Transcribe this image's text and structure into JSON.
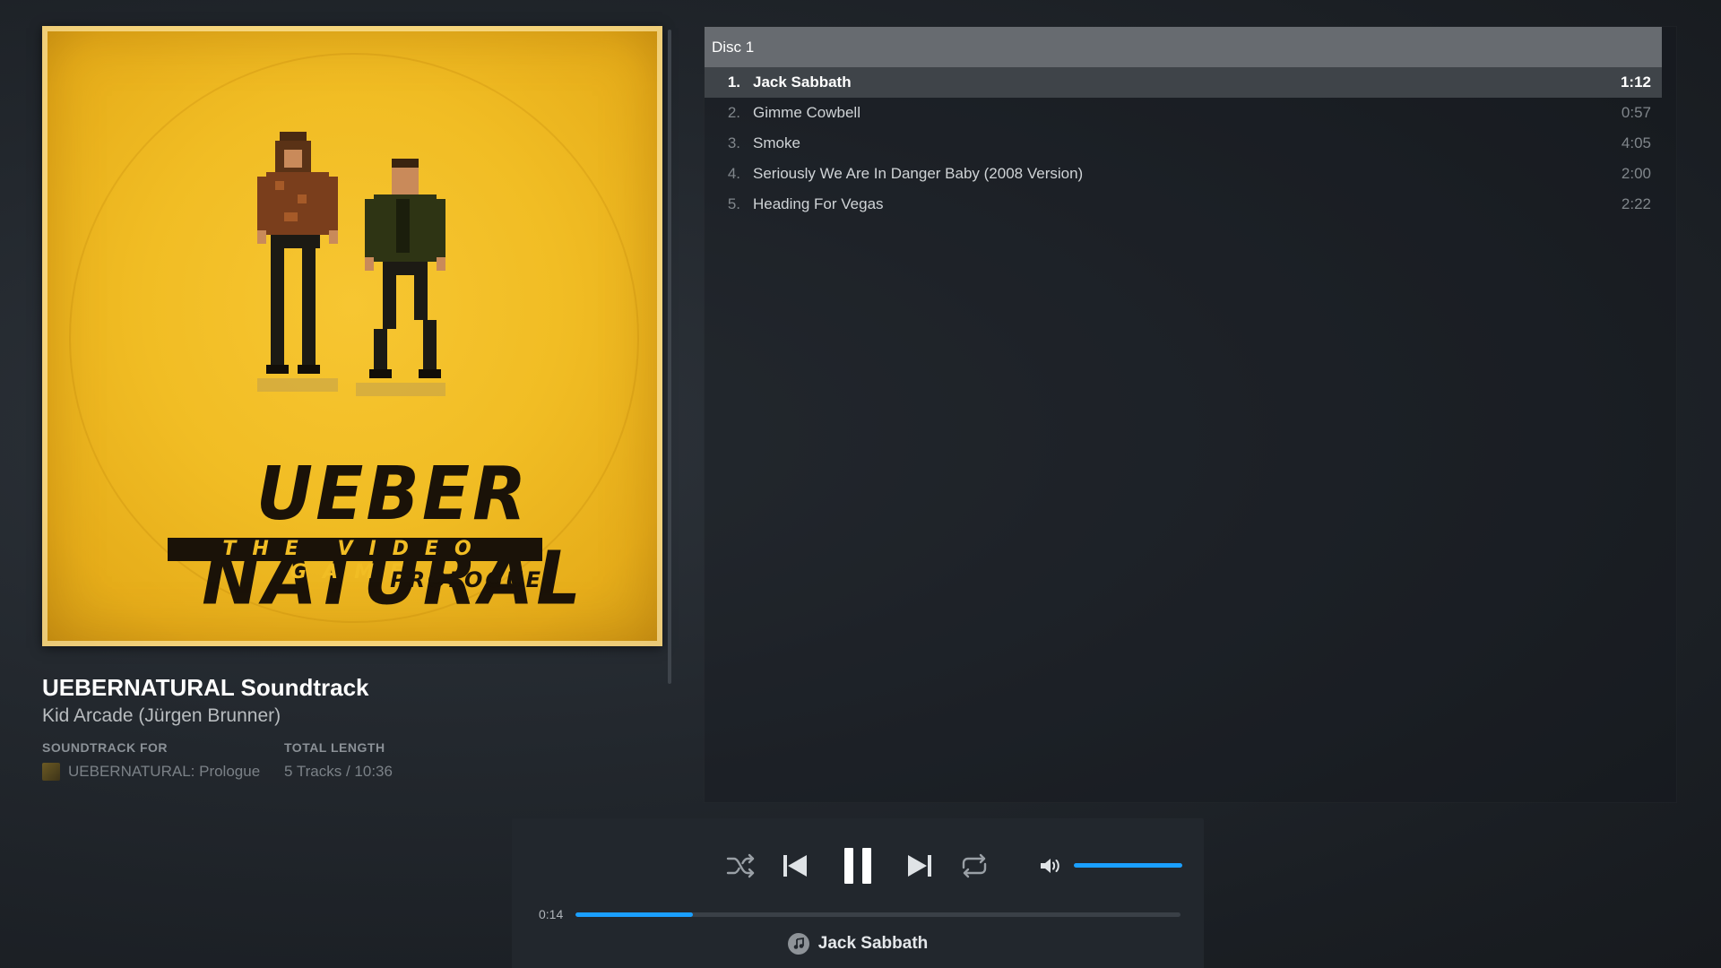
{
  "album": {
    "art_title": "UEBER NATURAL",
    "art_subtitle": "THE VIDEO GAME",
    "art_edition": "PROLOGUE",
    "title": "UEBERNATURAL Soundtrack",
    "artist": "Kid Arcade (Jürgen Brunner)",
    "soundtrack_for_label": "SOUNDTRACK FOR",
    "soundtrack_for_value": "UEBERNATURAL: Prologue",
    "total_length_label": "TOTAL LENGTH",
    "total_length_value": "5 Tracks / 10:36"
  },
  "tracklist": {
    "disc_label": "Disc 1",
    "tracks": [
      {
        "number": "1.",
        "name": "Jack Sabbath",
        "duration": "1:12",
        "active": true
      },
      {
        "number": "2.",
        "name": "Gimme Cowbell",
        "duration": "0:57",
        "active": false
      },
      {
        "number": "3.",
        "name": "Smoke",
        "duration": "4:05",
        "active": false
      },
      {
        "number": "4.",
        "name": "Seriously We Are In Danger Baby (2008 Version)",
        "duration": "2:00",
        "active": false
      },
      {
        "number": "5.",
        "name": "Heading For Vegas",
        "duration": "2:22",
        "active": false
      }
    ]
  },
  "player": {
    "elapsed": "0:14",
    "progress_fraction": 0.194,
    "volume_fraction": 1.0,
    "now_playing": "Jack Sabbath",
    "icons": [
      "shuffle-icon",
      "previous-icon",
      "pause-icon",
      "next-icon",
      "repeat-icon",
      "volume-icon",
      "music-note-icon"
    ],
    "accent_color": "#1a9fff"
  },
  "colors": {
    "art_background": "#f1bd24",
    "disc_header": "#676b70",
    "active_row": "#3f4449"
  }
}
